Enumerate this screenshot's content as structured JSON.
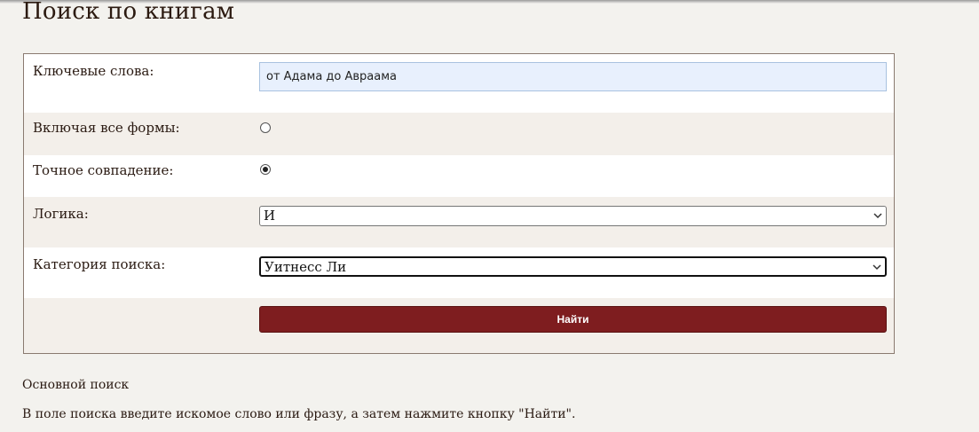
{
  "page": {
    "title": "Поиск по книгам"
  },
  "form": {
    "keywords_label": "Ключевые слова:",
    "keywords_value": "от Адама до Авраама",
    "all_forms_label": "Включая все формы:",
    "all_forms_checked": false,
    "exact_match_label": "Точное совпадение:",
    "exact_match_checked": true,
    "logic_label": "Логика:",
    "logic_selected": "И",
    "category_label": "Категория поиска:",
    "category_selected": "Уитнесс Ли",
    "submit_label": "Найти"
  },
  "help": {
    "heading": "Основной поиск",
    "text": "В поле поиска введите искомое слово или фразу, а затем нажмите кнопку \"Найти\"."
  },
  "colors": {
    "background": "#f3f2ee",
    "row_alt": "#f3efea",
    "submit_button": "#7e1d1f",
    "input_fill": "#e8f0fd"
  },
  "icons": {
    "select_chevron": "chevron-down-icon",
    "radio": "radio-button"
  }
}
